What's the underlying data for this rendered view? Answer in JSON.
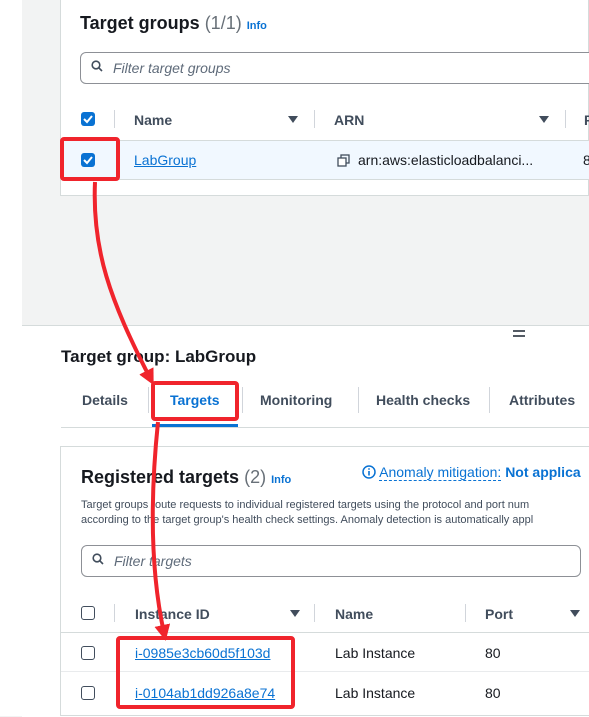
{
  "target_groups": {
    "title": "Target groups",
    "count": "(1/1)",
    "info": "Info",
    "search_placeholder": "Filter target groups",
    "columns": [
      "Name",
      "ARN",
      "F"
    ],
    "rows": [
      {
        "name": "LabGroup",
        "arn": "arn:aws:elasticloadbalanci...",
        "extra": "8"
      }
    ]
  },
  "details": {
    "title": "Target group: LabGroup",
    "tabs": [
      "Details",
      "Targets",
      "Monitoring",
      "Health checks",
      "Attributes"
    ],
    "active_tab": "Targets"
  },
  "registered_targets": {
    "title": "Registered targets",
    "count": "(2)",
    "info": "Info",
    "anomaly_label": "Anomaly mitigation:",
    "anomaly_value": "Not applica",
    "description_line1": "Target groups route requests to individual registered targets using the protocol and port num",
    "description_line2": "according to the target group's health check settings. Anomaly detection is automatically appl",
    "search_placeholder": "Filter targets",
    "columns": [
      "Instance ID",
      "Name",
      "Port"
    ],
    "rows": [
      {
        "id": "i-0985e3cb60d5f103d",
        "name": "Lab Instance",
        "port": "80"
      },
      {
        "id": "i-0104ab1dd926a8e74",
        "name": "Lab Instance",
        "port": "80"
      }
    ]
  },
  "colors": {
    "accent": "#0972d3",
    "annotation_red": "#f0242c",
    "selected_row": "#f1f8ff"
  }
}
